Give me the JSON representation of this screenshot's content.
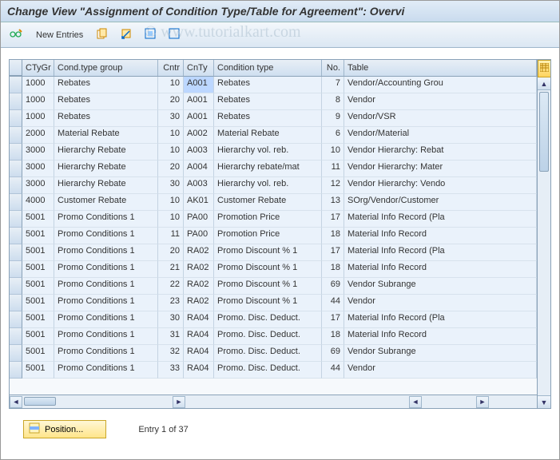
{
  "title": "Change View \"Assignment of Condition Type/Table for Agreement\": Overvi",
  "watermark": "© www.tutorialkart.com",
  "toolbar": {
    "new_entries_label": "New Entries"
  },
  "table": {
    "headers": {
      "ctygr": "CTyGr",
      "cgrp": "Cond.type group",
      "cntr": "Cntr",
      "cnty": "CnTy",
      "ctype": "Condition type",
      "no": "No.",
      "table": "Table"
    },
    "rows": [
      {
        "ctygr": "1000",
        "cgrp": "Rebates",
        "cntr": "10",
        "cnty": "A001",
        "ctype": "Rebates",
        "no": "7",
        "table": "Vendor/Accounting Grou",
        "hl": true
      },
      {
        "ctygr": "1000",
        "cgrp": "Rebates",
        "cntr": "20",
        "cnty": "A001",
        "ctype": "Rebates",
        "no": "8",
        "table": "Vendor"
      },
      {
        "ctygr": "1000",
        "cgrp": "Rebates",
        "cntr": "30",
        "cnty": "A001",
        "ctype": "Rebates",
        "no": "9",
        "table": "Vendor/VSR"
      },
      {
        "ctygr": "2000",
        "cgrp": "Material Rebate",
        "cntr": "10",
        "cnty": "A002",
        "ctype": "Material Rebate",
        "no": "6",
        "table": "Vendor/Material"
      },
      {
        "ctygr": "3000",
        "cgrp": "Hierarchy Rebate",
        "cntr": "10",
        "cnty": "A003",
        "ctype": "Hierarchy vol. reb.",
        "no": "10",
        "table": "Vendor Hierarchy: Rebat"
      },
      {
        "ctygr": "3000",
        "cgrp": "Hierarchy Rebate",
        "cntr": "20",
        "cnty": "A004",
        "ctype": "Hierarchy rebate/mat",
        "no": "11",
        "table": "Vendor Hierarchy: Mater"
      },
      {
        "ctygr": "3000",
        "cgrp": "Hierarchy Rebate",
        "cntr": "30",
        "cnty": "A003",
        "ctype": "Hierarchy vol. reb.",
        "no": "12",
        "table": "Vendor Hierarchy: Vendo"
      },
      {
        "ctygr": "4000",
        "cgrp": "Customer Rebate",
        "cntr": "10",
        "cnty": "AK01",
        "ctype": "Customer Rebate",
        "no": "13",
        "table": "SOrg/Vendor/Customer"
      },
      {
        "ctygr": "5001",
        "cgrp": "Promo Conditions 1",
        "cntr": "10",
        "cnty": "PA00",
        "ctype": "Promotion Price",
        "no": "17",
        "table": "Material Info Record (Pla"
      },
      {
        "ctygr": "5001",
        "cgrp": "Promo Conditions 1",
        "cntr": "11",
        "cnty": "PA00",
        "ctype": "Promotion Price",
        "no": "18",
        "table": "Material Info Record"
      },
      {
        "ctygr": "5001",
        "cgrp": "Promo Conditions 1",
        "cntr": "20",
        "cnty": "RA02",
        "ctype": "Promo Discount % 1",
        "no": "17",
        "table": "Material Info Record (Pla"
      },
      {
        "ctygr": "5001",
        "cgrp": "Promo Conditions 1",
        "cntr": "21",
        "cnty": "RA02",
        "ctype": "Promo Discount % 1",
        "no": "18",
        "table": "Material Info Record"
      },
      {
        "ctygr": "5001",
        "cgrp": "Promo Conditions 1",
        "cntr": "22",
        "cnty": "RA02",
        "ctype": "Promo Discount % 1",
        "no": "69",
        "table": "Vendor Subrange"
      },
      {
        "ctygr": "5001",
        "cgrp": "Promo Conditions 1",
        "cntr": "23",
        "cnty": "RA02",
        "ctype": "Promo Discount % 1",
        "no": "44",
        "table": "Vendor"
      },
      {
        "ctygr": "5001",
        "cgrp": "Promo Conditions 1",
        "cntr": "30",
        "cnty": "RA04",
        "ctype": "Promo. Disc. Deduct.",
        "no": "17",
        "table": "Material Info Record (Pla"
      },
      {
        "ctygr": "5001",
        "cgrp": "Promo Conditions 1",
        "cntr": "31",
        "cnty": "RA04",
        "ctype": "Promo. Disc. Deduct.",
        "no": "18",
        "table": "Material Info Record"
      },
      {
        "ctygr": "5001",
        "cgrp": "Promo Conditions 1",
        "cntr": "32",
        "cnty": "RA04",
        "ctype": "Promo. Disc. Deduct.",
        "no": "69",
        "table": "Vendor Subrange"
      },
      {
        "ctygr": "5001",
        "cgrp": "Promo Conditions 1",
        "cntr": "33",
        "cnty": "RA04",
        "ctype": "Promo. Disc. Deduct.",
        "no": "44",
        "table": "Vendor"
      }
    ]
  },
  "footer": {
    "position_label": "Position...",
    "entry_label": "Entry 1 of 37"
  }
}
